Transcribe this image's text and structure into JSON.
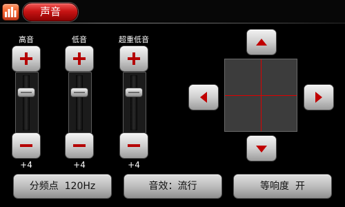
{
  "header": {
    "title": "声音",
    "app_icon": "equalizer-icon"
  },
  "sliders": [
    {
      "label": "高音",
      "value": "+4"
    },
    {
      "label": "低音",
      "value": "+4"
    },
    {
      "label": "超重低音",
      "value": "+4"
    }
  ],
  "balance": {
    "up_icon": "arrow-up-icon",
    "down_icon": "arrow-down-icon",
    "left_icon": "arrow-left-icon",
    "right_icon": "arrow-right-icon"
  },
  "buttons": {
    "crossover": "分频点  120Hz",
    "effect": "音效：流行",
    "loudness": "等响度  开"
  },
  "colors": {
    "accent_red": "#c81414",
    "crosshair": "#e00000",
    "background": "#000000"
  }
}
